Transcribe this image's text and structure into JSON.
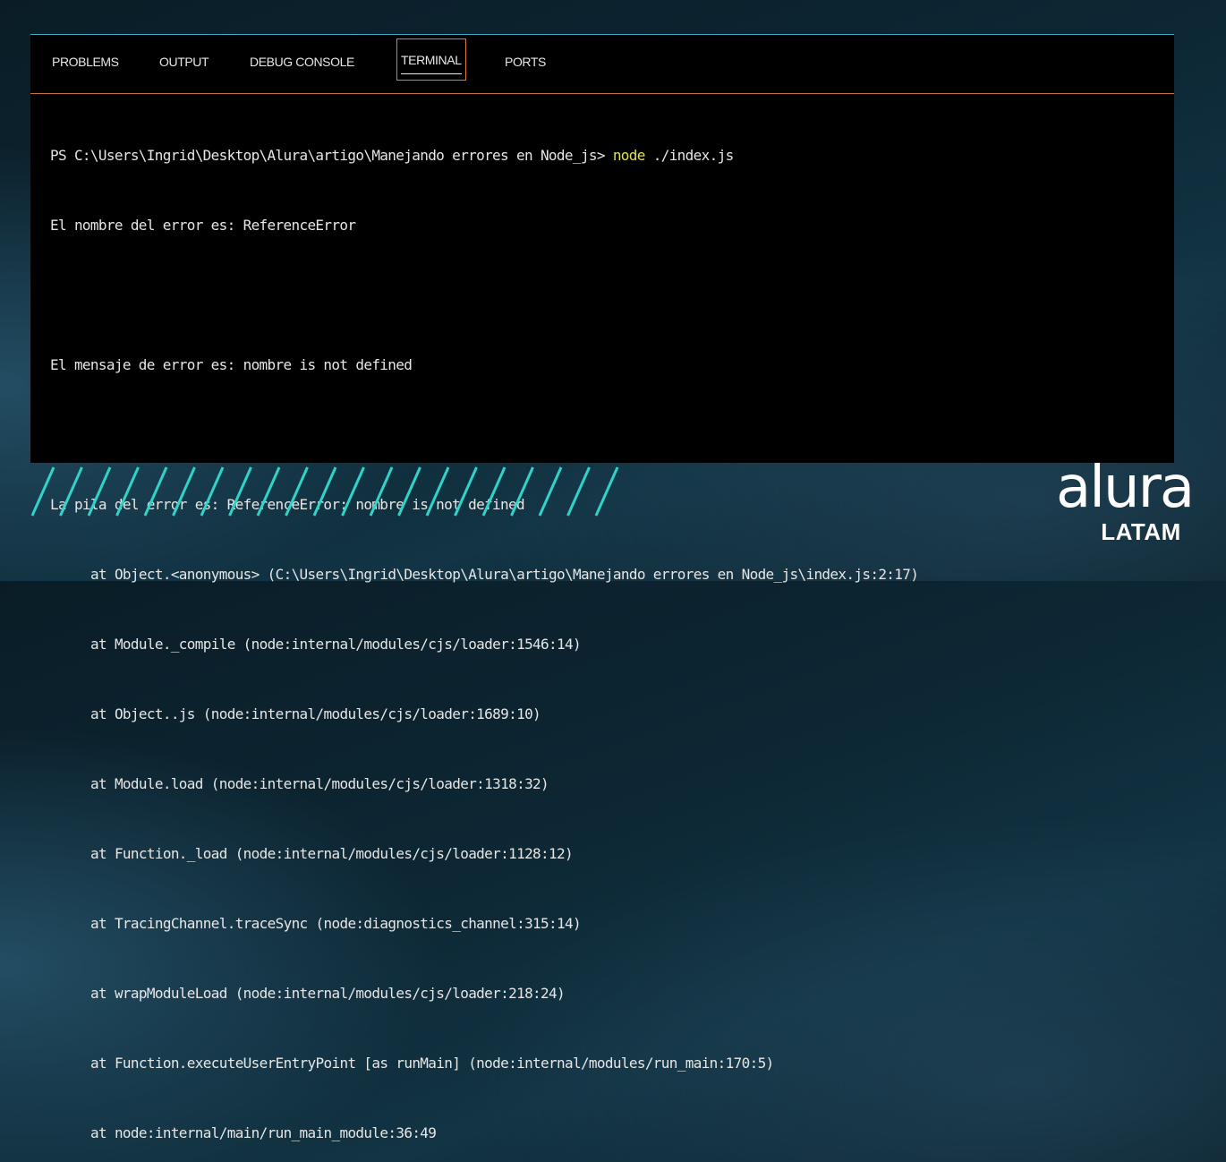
{
  "panel": {
    "tabs": [
      {
        "label": "PROBLEMS"
      },
      {
        "label": "OUTPUT"
      },
      {
        "label": "DEBUG CONSOLE"
      },
      {
        "label": "TERMINAL",
        "active": true
      },
      {
        "label": "PORTS"
      }
    ]
  },
  "terminal": {
    "prompt": "PS C:\\Users\\Ingrid\\Desktop\\Alura\\artigo\\Manejando errores en Node_js> ",
    "command_name": "node",
    "command_args": " ./index.js",
    "lines": [
      "El nombre del error es: ReferenceError",
      "",
      "El mensaje de error es: nombre is not defined",
      "",
      "La pila del error es: ReferenceError: nombre is not defined"
    ],
    "stack": [
      "at Object.<anonymous> (C:\\Users\\Ingrid\\Desktop\\Alura\\artigo\\Manejando errores en Node_js\\index.js:2:17)",
      "at Module._compile (node:internal/modules/cjs/loader:1546:14)",
      "at Object..js (node:internal/modules/cjs/loader:1689:10)",
      "at Module.load (node:internal/modules/cjs/loader:1318:32)",
      "at Function._load (node:internal/modules/cjs/loader:1128:12)",
      "at TracingChannel.traceSync (node:diagnostics_channel:315:14)",
      "at wrapModuleLoad (node:internal/modules/cjs/loader:218:24)",
      "at Function.executeUserEntryPoint [as runMain] (node:internal/modules/run_main:170:5)",
      "at node:internal/main/run_main_module:36:49"
    ]
  },
  "logo": {
    "word": "alura",
    "sub": "LATAM"
  },
  "colors": {
    "accent_tab_border": "#e07b2e",
    "panel_top_border": "#3fa8c4",
    "command_highlight": "#e3e052",
    "stripe": "#2fd3c7"
  }
}
